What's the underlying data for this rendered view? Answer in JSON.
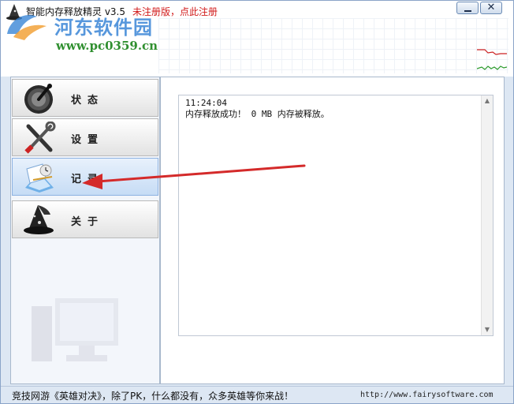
{
  "window": {
    "title": "智能内存释放精灵 v3.5",
    "registration_link": "未注册版，点此注册",
    "minimize_icon": "minimize-icon",
    "close_icon": "close-icon",
    "close_glyph": "✕"
  },
  "watermark": {
    "title": "河东软件园",
    "url": "www.pc0359.cn"
  },
  "sidebar": {
    "items": [
      {
        "label": "状态",
        "icon": "gauge-icon"
      },
      {
        "label": "设置",
        "icon": "tools-icon"
      },
      {
        "label": "记录",
        "icon": "log-book-icon",
        "selected": true
      },
      {
        "label": "关于",
        "icon": "wizard-hat-icon"
      }
    ]
  },
  "log": {
    "entries": [
      {
        "time": "11:24:04",
        "message": "内存释放成功！ 0 MB 内存被释放。"
      }
    ]
  },
  "statusbar": {
    "ad_text": "竞技网游《英雄对决》，除了PK，什么都没有，众多英雄等你来战！",
    "url": "http://www.fairysoftware.com"
  },
  "colors": {
    "title_registration": "#d11a1a",
    "selected_nav": "#c6dcf5",
    "annotation_arrow": "#d42a2a",
    "graph_red": "#cc2222",
    "graph_green": "#2a9a2a"
  }
}
